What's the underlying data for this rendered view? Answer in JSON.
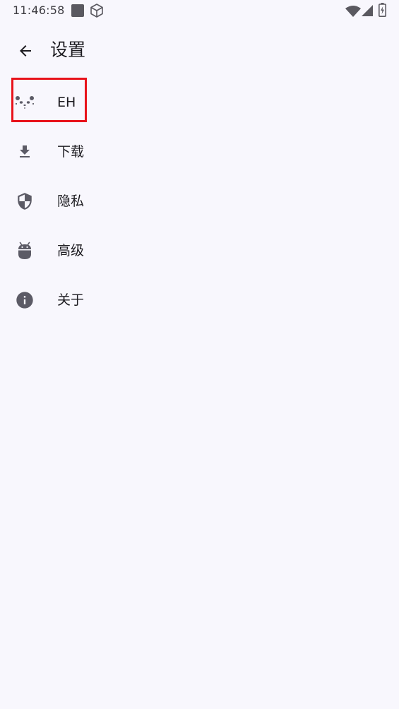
{
  "status_bar": {
    "time": "11:46:58",
    "icons": [
      "stop-square-icon",
      "cube-icon",
      "wifi-icon",
      "signal-icon",
      "battery-charging-icon"
    ]
  },
  "app_bar": {
    "back_icon": "arrow-back-icon",
    "title": "设置"
  },
  "settings": {
    "items": [
      {
        "label": "EH",
        "icon": "panda-icon",
        "highlighted": true
      },
      {
        "label": "下载",
        "icon": "download-icon"
      },
      {
        "label": "隐私",
        "icon": "shield-icon"
      },
      {
        "label": "高级",
        "icon": "android-icon"
      },
      {
        "label": "关于",
        "icon": "info-icon"
      }
    ]
  },
  "colors": {
    "background": "#f8f7fd",
    "icon": "#5c5b66",
    "text": "#1c1b20",
    "highlight": "#e8131b"
  }
}
